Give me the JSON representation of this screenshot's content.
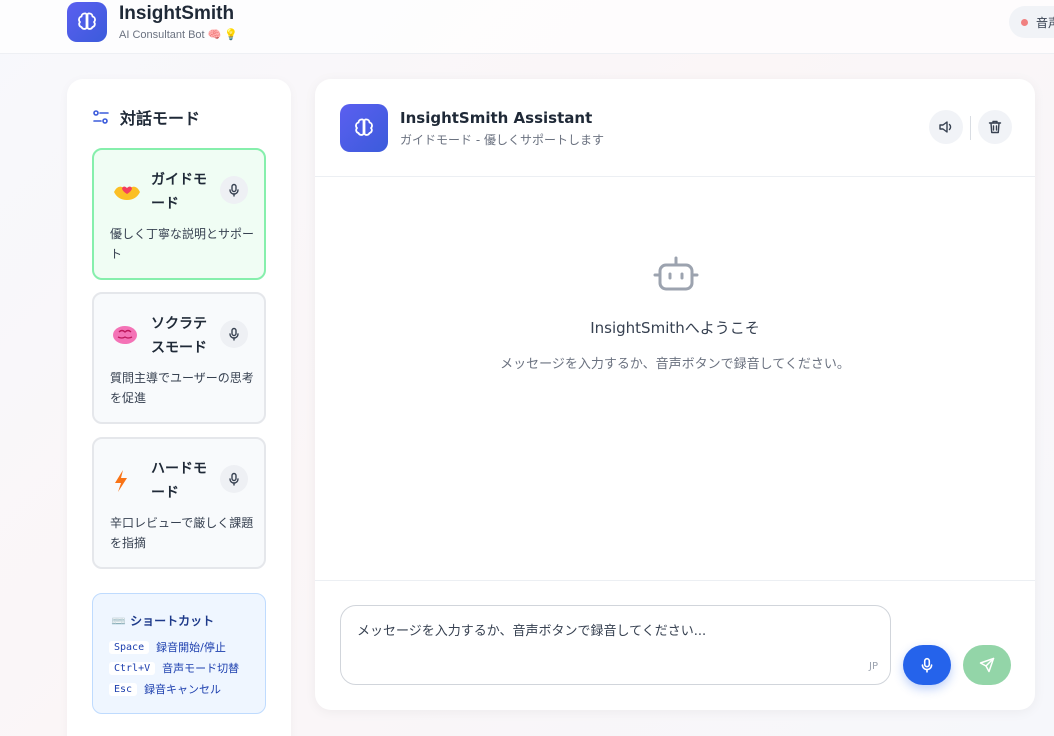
{
  "app": {
    "title": "InsightSmith",
    "subtitle": "AI Consultant Bot 🧠 💡",
    "status_label": "音声"
  },
  "sidebar": {
    "heading": "対話モード",
    "modes": [
      {
        "name": "ガイドモード",
        "description": "優しく丁寧な説明とサポート",
        "icon": "heart-hands-icon",
        "active": true
      },
      {
        "name": "ソクラテスモード",
        "description": "質問主導でユーザーの思考を促進",
        "icon": "brain-icon",
        "active": false
      },
      {
        "name": "ハードモード",
        "description": "辛口レビューで厳しく課題を指摘",
        "icon": "lightning-icon",
        "active": false
      }
    ],
    "shortcuts": {
      "title": "⌨️ ショートカット",
      "items": [
        {
          "key": "Space",
          "label": "録音開始/停止"
        },
        {
          "key": "Ctrl+V",
          "label": "音声モード切替"
        },
        {
          "key": "Esc",
          "label": "録音キャンセル"
        }
      ]
    }
  },
  "chat": {
    "assistant_name": "InsightSmith Assistant",
    "assistant_mode": "ガイドモード - 優しくサポートします",
    "welcome_title": "InsightSmithへようこそ",
    "welcome_sub": "メッセージを入力するか、音声ボタンで録音してください。",
    "input_placeholder": "メッセージを入力するか、音声ボタンで録音してください...",
    "lang": "JP"
  },
  "colors": {
    "brand": "#3b5bdb",
    "active_card_bg": "#f0fdf4",
    "active_card_border": "#86efac",
    "mic_button": "#2563eb",
    "send_button": "#93d5a8"
  }
}
